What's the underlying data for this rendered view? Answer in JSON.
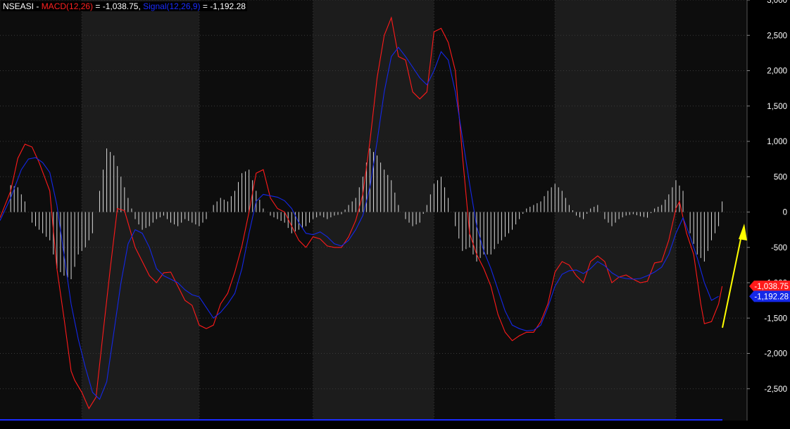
{
  "header": {
    "ticker": "NSEASI",
    "sep": " - ",
    "macd_label": "MACD(12,26)",
    "macd_value": "-1,038.75",
    "signal_label": "Signal(12,26,9)",
    "signal_value": "-1,192.28"
  },
  "colors": {
    "background": "#000000",
    "band_light": "#1c1c1c",
    "band_dark": "#0d0d0d",
    "grid": "#3a3a3a",
    "macd": "#ff1a1a",
    "signal": "#1428e8",
    "histogram": "#d8d8d8",
    "arrow": "#ffff00",
    "bottom_line": "#1a2cff"
  },
  "chart_data": {
    "type": "line",
    "ylim": [
      -2950,
      3000
    ],
    "yticks": [
      {
        "value": 3000,
        "label": "3,000"
      },
      {
        "value": 2500,
        "label": "2,500"
      },
      {
        "value": 2000,
        "label": "2,000"
      },
      {
        "value": 1500,
        "label": "1,500"
      },
      {
        "value": 1000,
        "label": "1,000"
      },
      {
        "value": 500,
        "label": "500"
      },
      {
        "value": 0,
        "label": "0"
      },
      {
        "value": -500,
        "label": "-500"
      },
      {
        "value": -1000,
        "label": "-1,000"
      },
      {
        "value": -1500,
        "label": "-1,500"
      },
      {
        "value": -2000,
        "label": "-2,000"
      },
      {
        "value": -2500,
        "label": "-2,500"
      }
    ],
    "bars": 210,
    "series": [
      {
        "name": "MACD(12,26)",
        "color": "#ff1a1a",
        "last_label": "-1,038.75",
        "points": [
          [
            0,
            -80
          ],
          [
            3,
            300
          ],
          [
            5,
            760
          ],
          [
            7,
            960
          ],
          [
            9,
            920
          ],
          [
            11,
            700
          ],
          [
            14,
            300
          ],
          [
            16,
            -800
          ],
          [
            18,
            -1500
          ],
          [
            20,
            -2250
          ],
          [
            21,
            -2380
          ],
          [
            23,
            -2550
          ],
          [
            25,
            -2780
          ],
          [
            27,
            -2620
          ],
          [
            29,
            -1700
          ],
          [
            31,
            -800
          ],
          [
            33,
            50
          ],
          [
            35,
            20
          ],
          [
            38,
            -500
          ],
          [
            40,
            -700
          ],
          [
            42,
            -900
          ],
          [
            44,
            -1000
          ],
          [
            46,
            -860
          ],
          [
            48,
            -850
          ],
          [
            50,
            -1050
          ],
          [
            52,
            -1250
          ],
          [
            54,
            -1320
          ],
          [
            56,
            -1600
          ],
          [
            58,
            -1650
          ],
          [
            60,
            -1600
          ],
          [
            62,
            -1300
          ],
          [
            64,
            -1150
          ],
          [
            66,
            -850
          ],
          [
            68,
            -480
          ],
          [
            70,
            0
          ],
          [
            72,
            550
          ],
          [
            74,
            600
          ],
          [
            76,
            200
          ],
          [
            78,
            50
          ],
          [
            80,
            0
          ],
          [
            82,
            -200
          ],
          [
            84,
            -400
          ],
          [
            86,
            -500
          ],
          [
            88,
            -350
          ],
          [
            90,
            -380
          ],
          [
            92,
            -480
          ],
          [
            94,
            -500
          ],
          [
            96,
            -500
          ],
          [
            98,
            -350
          ],
          [
            100,
            -120
          ],
          [
            102,
            250
          ],
          [
            104,
            1000
          ],
          [
            106,
            1900
          ],
          [
            108,
            2500
          ],
          [
            110,
            2750
          ],
          [
            112,
            2200
          ],
          [
            114,
            2150
          ],
          [
            116,
            1700
          ],
          [
            118,
            1600
          ],
          [
            120,
            1700
          ],
          [
            122,
            2550
          ],
          [
            124,
            2600
          ],
          [
            126,
            2400
          ],
          [
            128,
            2000
          ],
          [
            130,
            800
          ],
          [
            132,
            -300
          ],
          [
            134,
            -600
          ],
          [
            136,
            -800
          ],
          [
            138,
            -1050
          ],
          [
            140,
            -1450
          ],
          [
            142,
            -1700
          ],
          [
            144,
            -1820
          ],
          [
            146,
            -1750
          ],
          [
            148,
            -1700
          ],
          [
            150,
            -1700
          ],
          [
            152,
            -1550
          ],
          [
            154,
            -1300
          ],
          [
            156,
            -850
          ],
          [
            158,
            -700
          ],
          [
            160,
            -750
          ],
          [
            162,
            -900
          ],
          [
            164,
            -1000
          ],
          [
            166,
            -700
          ],
          [
            168,
            -620
          ],
          [
            170,
            -700
          ],
          [
            172,
            -1000
          ],
          [
            174,
            -920
          ],
          [
            176,
            -890
          ],
          [
            178,
            -950
          ],
          [
            180,
            -1000
          ],
          [
            182,
            -980
          ],
          [
            184,
            -720
          ],
          [
            186,
            -700
          ],
          [
            188,
            -400
          ],
          [
            190,
            50
          ],
          [
            191,
            150
          ],
          [
            193,
            -300
          ],
          [
            195,
            -600
          ],
          [
            197,
            -1300
          ],
          [
            198,
            -1580
          ],
          [
            200,
            -1550
          ],
          [
            202,
            -1300
          ],
          [
            203,
            -1050
          ]
        ]
      },
      {
        "name": "Signal(12,26,9)",
        "color": "#1428e8",
        "last_label": "-1,192.28",
        "points": [
          [
            0,
            -120
          ],
          [
            3,
            200
          ],
          [
            6,
            600
          ],
          [
            8,
            750
          ],
          [
            10,
            770
          ],
          [
            12,
            700
          ],
          [
            14,
            560
          ],
          [
            16,
            100
          ],
          [
            18,
            -600
          ],
          [
            20,
            -1300
          ],
          [
            22,
            -1800
          ],
          [
            24,
            -2200
          ],
          [
            26,
            -2550
          ],
          [
            28,
            -2650
          ],
          [
            30,
            -2400
          ],
          [
            32,
            -1700
          ],
          [
            34,
            -1000
          ],
          [
            36,
            -450
          ],
          [
            38,
            -250
          ],
          [
            40,
            -300
          ],
          [
            42,
            -500
          ],
          [
            44,
            -800
          ],
          [
            46,
            -900
          ],
          [
            48,
            -950
          ],
          [
            50,
            -1000
          ],
          [
            52,
            -1100
          ],
          [
            54,
            -1170
          ],
          [
            56,
            -1200
          ],
          [
            58,
            -1350
          ],
          [
            60,
            -1500
          ],
          [
            62,
            -1420
          ],
          [
            64,
            -1300
          ],
          [
            66,
            -1150
          ],
          [
            68,
            -800
          ],
          [
            70,
            -300
          ],
          [
            72,
            150
          ],
          [
            74,
            250
          ],
          [
            76,
            230
          ],
          [
            78,
            210
          ],
          [
            80,
            160
          ],
          [
            82,
            50
          ],
          [
            84,
            -150
          ],
          [
            86,
            -300
          ],
          [
            88,
            -320
          ],
          [
            90,
            -280
          ],
          [
            92,
            -350
          ],
          [
            94,
            -450
          ],
          [
            96,
            -480
          ],
          [
            98,
            -400
          ],
          [
            100,
            -250
          ],
          [
            102,
            -50
          ],
          [
            104,
            350
          ],
          [
            106,
            1000
          ],
          [
            108,
            1700
          ],
          [
            110,
            2200
          ],
          [
            112,
            2330
          ],
          [
            114,
            2200
          ],
          [
            116,
            2050
          ],
          [
            118,
            1900
          ],
          [
            120,
            1800
          ],
          [
            122,
            2000
          ],
          [
            124,
            2270
          ],
          [
            126,
            2150
          ],
          [
            128,
            1700
          ],
          [
            130,
            1050
          ],
          [
            132,
            400
          ],
          [
            134,
            -200
          ],
          [
            136,
            -550
          ],
          [
            138,
            -800
          ],
          [
            140,
            -1100
          ],
          [
            142,
            -1400
          ],
          [
            144,
            -1600
          ],
          [
            146,
            -1650
          ],
          [
            148,
            -1680
          ],
          [
            150,
            -1670
          ],
          [
            152,
            -1600
          ],
          [
            154,
            -1350
          ],
          [
            156,
            -1050
          ],
          [
            158,
            -880
          ],
          [
            160,
            -830
          ],
          [
            162,
            -820
          ],
          [
            164,
            -870
          ],
          [
            166,
            -800
          ],
          [
            168,
            -700
          ],
          [
            170,
            -760
          ],
          [
            172,
            -860
          ],
          [
            174,
            -920
          ],
          [
            176,
            -940
          ],
          [
            178,
            -950
          ],
          [
            180,
            -940
          ],
          [
            182,
            -900
          ],
          [
            184,
            -850
          ],
          [
            186,
            -780
          ],
          [
            188,
            -600
          ],
          [
            190,
            -300
          ],
          [
            192,
            -80
          ],
          [
            194,
            -350
          ],
          [
            196,
            -650
          ],
          [
            198,
            -1000
          ],
          [
            200,
            -1250
          ],
          [
            202,
            -1192
          ]
        ]
      },
      {
        "name": "Histogram",
        "color": "#d8d8d8",
        "points": [
          [
            3,
            380
          ],
          [
            5,
            350
          ],
          [
            7,
            150
          ],
          [
            9,
            -150
          ],
          [
            12,
            -300
          ],
          [
            14,
            -400
          ],
          [
            16,
            -800
          ],
          [
            18,
            -900
          ],
          [
            20,
            -950
          ],
          [
            22,
            -600
          ],
          [
            24,
            -500
          ],
          [
            26,
            -300
          ],
          [
            28,
            300
          ],
          [
            30,
            900
          ],
          [
            32,
            800
          ],
          [
            34,
            500
          ],
          [
            36,
            200
          ],
          [
            38,
            -100
          ],
          [
            40,
            -250
          ],
          [
            42,
            -200
          ],
          [
            44,
            -100
          ],
          [
            46,
            -50
          ],
          [
            48,
            -150
          ],
          [
            50,
            -200
          ],
          [
            52,
            -100
          ],
          [
            54,
            -150
          ],
          [
            56,
            -200
          ],
          [
            58,
            -100
          ],
          [
            60,
            100
          ],
          [
            62,
            200
          ],
          [
            64,
            150
          ],
          [
            66,
            300
          ],
          [
            68,
            550
          ],
          [
            70,
            600
          ],
          [
            72,
            300
          ],
          [
            74,
            50
          ],
          [
            76,
            -50
          ],
          [
            78,
            -100
          ],
          [
            80,
            -150
          ],
          [
            82,
            -300
          ],
          [
            84,
            -250
          ],
          [
            86,
            -200
          ],
          [
            88,
            -100
          ],
          [
            90,
            -50
          ],
          [
            92,
            -100
          ],
          [
            94,
            -50
          ],
          [
            96,
            -30
          ],
          [
            98,
            100
          ],
          [
            100,
            200
          ],
          [
            102,
            500
          ],
          [
            104,
            900
          ],
          [
            106,
            800
          ],
          [
            108,
            600
          ],
          [
            110,
            450
          ],
          [
            112,
            100
          ],
          [
            114,
            -100
          ],
          [
            116,
            -200
          ],
          [
            118,
            -150
          ],
          [
            120,
            100
          ],
          [
            122,
            400
          ],
          [
            124,
            500
          ],
          [
            126,
            200
          ],
          [
            128,
            -200
          ],
          [
            130,
            -550
          ],
          [
            132,
            -500
          ],
          [
            134,
            -700
          ],
          [
            136,
            -600
          ],
          [
            138,
            -600
          ],
          [
            140,
            -450
          ],
          [
            142,
            -350
          ],
          [
            144,
            -250
          ],
          [
            146,
            -100
          ],
          [
            148,
            50
          ],
          [
            150,
            100
          ],
          [
            152,
            150
          ],
          [
            154,
            300
          ],
          [
            156,
            400
          ],
          [
            158,
            300
          ],
          [
            160,
            100
          ],
          [
            162,
            -50
          ],
          [
            164,
            -100
          ],
          [
            166,
            50
          ],
          [
            168,
            100
          ],
          [
            170,
            -100
          ],
          [
            172,
            -200
          ],
          [
            174,
            -100
          ],
          [
            176,
            -50
          ],
          [
            178,
            -30
          ],
          [
            180,
            -60
          ],
          [
            182,
            -80
          ],
          [
            184,
            50
          ],
          [
            186,
            100
          ],
          [
            188,
            250
          ],
          [
            190,
            450
          ],
          [
            192,
            300
          ],
          [
            194,
            -300
          ],
          [
            196,
            -600
          ],
          [
            198,
            -700
          ],
          [
            200,
            -400
          ],
          [
            202,
            -200
          ],
          [
            203,
            150
          ]
        ]
      }
    ]
  }
}
